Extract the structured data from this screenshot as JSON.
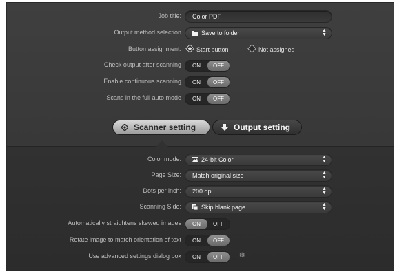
{
  "top": {
    "job_title": {
      "label": "Job title:",
      "value": "Color PDF"
    },
    "output_method": {
      "label": "Output method selection",
      "value": "Save to folder",
      "icon": "folder-icon"
    },
    "button_assignment": {
      "label": "Button assignment:",
      "options": [
        {
          "label": "Start button",
          "selected": true
        },
        {
          "label": "Not assigned",
          "selected": false
        }
      ]
    },
    "check_output": {
      "label": "Check output after scanning",
      "on": "ON",
      "off": "OFF",
      "state": "off"
    },
    "continuous": {
      "label": "Enable continuous scanning",
      "on": "ON",
      "off": "OFF",
      "state": "off"
    },
    "full_auto": {
      "label": "Scans in the full auto mode",
      "on": "ON",
      "off": "OFF",
      "state": "off"
    }
  },
  "tabs": [
    {
      "label": "Scanner setting",
      "active": true,
      "icon": "diamond-icon"
    },
    {
      "label": "Output setting",
      "active": false,
      "icon": "arrow-down-icon"
    }
  ],
  "bottom": {
    "color_mode": {
      "label": "Color mode:",
      "value": "24-bit Color",
      "icon": "color-image-icon"
    },
    "page_size": {
      "label": "Page Size:",
      "value": "Match original size"
    },
    "dpi": {
      "label": "Dots per inch:",
      "value": "200 dpi"
    },
    "side": {
      "label": "Scanning Side:",
      "value": "Skip blank page",
      "icon": "pages-icon"
    },
    "straighten": {
      "label": "Automatically straightens skewed images",
      "on": "ON",
      "off": "OFF",
      "state": "on"
    },
    "rotate": {
      "label": "Rotate image to match orientation of text",
      "on": "ON",
      "off": "OFF",
      "state": "off"
    },
    "advanced": {
      "label": "Use advanced settings dialog box",
      "on": "ON",
      "off": "OFF",
      "state": "off"
    }
  },
  "colors": {
    "panel": "#3a3a3a",
    "active_tab": "#c8c8c8"
  }
}
